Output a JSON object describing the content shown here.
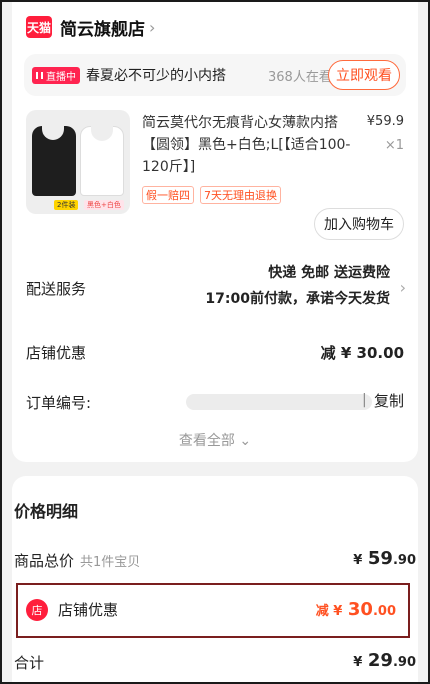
{
  "shop": {
    "badge": "天猫",
    "name": "简云旗舰店",
    "arrow": "›"
  },
  "live": {
    "badge": "直播中",
    "text": "春夏必不可少的小内搭",
    "count": "368人在看",
    "button": "立即观看"
  },
  "product": {
    "title": "简云莫代尔无痕背心女薄款内搭【圆领】黑色+白色;L[【适合100-120斤】]",
    "price": "¥59.9",
    "qty": "×1",
    "image_labels": [
      "2件装",
      "黑色+白色"
    ],
    "tags": [
      "假一赔四",
      "7天无理由退换"
    ],
    "cart_button": "加入购物车"
  },
  "delivery": {
    "label": "配送服务",
    "line1": "快递 免邮 送运费险",
    "line2": "17:00前付款，承诺今天发货"
  },
  "shop_discount": {
    "label": "店铺优惠",
    "value": "减 ¥ 30.00"
  },
  "order": {
    "label": "订单编号:",
    "divider": "|",
    "copy": "复制"
  },
  "view_all": "查看全部 ⌄",
  "price_detail": {
    "title": "价格明细",
    "total_label": "商品总价",
    "total_sub": "共1件宝贝",
    "total_cur": "¥",
    "total_int": "59",
    "total_dec": ".90",
    "disc_icon": "店",
    "disc_label": "店铺优惠",
    "disc_pre": "减 ¥",
    "disc_int": "30",
    "disc_dec": ".00",
    "sum_label": "合计",
    "sum_cur": "¥",
    "sum_int": "29",
    "sum_dec": ".90"
  },
  "colors": {
    "accent": "#ff5021",
    "tmall_red": "#ff1e3c",
    "highlight_border": "#7a1e1e"
  }
}
